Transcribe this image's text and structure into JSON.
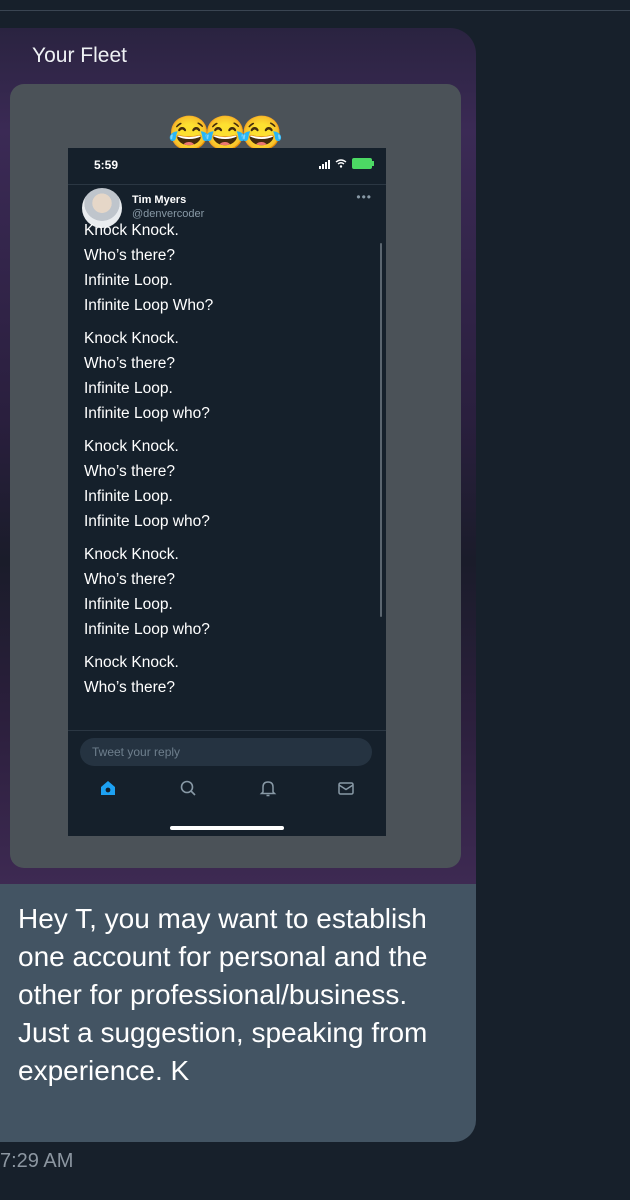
{
  "card": {
    "title": "Your Fleet"
  },
  "screenshot": {
    "emoji": "😂😂😂",
    "status_time": "5:59",
    "author": {
      "name": "Tim Myers",
      "handle": "@denvercoder"
    },
    "more_icon": "•••",
    "stanzas": [
      [
        "Knock Knock.",
        "Who’s there?",
        "Infinite Loop.",
        "Infinite Loop Who?"
      ],
      [
        "Knock Knock.",
        "Who’s there?",
        "Infinite Loop.",
        "Infinite Loop who?"
      ],
      [
        "Knock Knock.",
        "Who’s there?",
        "Infinite Loop.",
        "Infinite Loop who?"
      ],
      [
        "Knock Knock.",
        "Who’s there?",
        "Infinite Loop.",
        "Infinite Loop who?"
      ],
      [
        "Knock Knock.",
        "Who’s there?"
      ]
    ],
    "reply_placeholder": "Tweet your reply",
    "tabs": [
      "home-icon",
      "search-icon",
      "bell-icon",
      "mail-icon"
    ],
    "accent_color": "#1da1f2"
  },
  "message": {
    "text": "Hey T, you may want to establish one account for personal and the other for professional/business. Just a suggestion, speaking from experience. K",
    "timestamp": "7:29 AM"
  }
}
